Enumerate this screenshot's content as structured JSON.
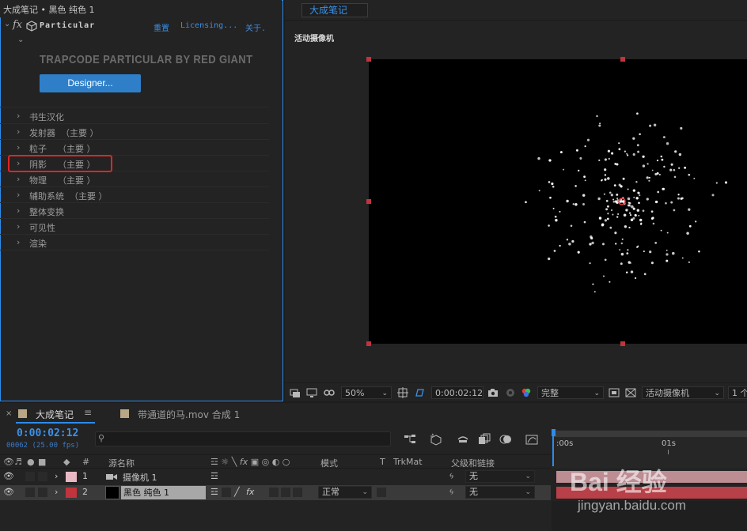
{
  "effect_controls": {
    "title": "大成笔记 • 黑色 纯色 1",
    "fx_label": "fx",
    "effect_name": "Particular",
    "reset": "重置",
    "licensing": "Licensing...",
    "about": "关于.",
    "plugin_title": "TRAPCODE PARTICULAR BY RED GIANT",
    "designer_button": "Designer...",
    "groups": [
      "书生汉化",
      "发射器  （主要 ）",
      "粒子    （主要 ）",
      "阴影    （主要 ）",
      "物理    （主要 ）",
      "辅助系统  （主要 ）",
      "整体变换",
      "可见性",
      "渲染"
    ],
    "highlighted_group": "阴影    （主要 ）"
  },
  "composition": {
    "tab_label": "大成笔记",
    "camera_label": "活动摄像机",
    "toolbar": {
      "zoom": "50%",
      "timecode": "0:00:02:12",
      "resolution": "完整",
      "view": "活动摄像机",
      "views_count": "1 个"
    }
  },
  "timeline": {
    "tabs": [
      {
        "label": "大成笔记",
        "menu": "≡",
        "close": "×"
      },
      {
        "label": "带通道的马.mov 合成 1"
      }
    ],
    "current_time": "0:00:02:12",
    "frames": "00062 (25.00 fps)",
    "columns": {
      "number": "#",
      "source_name": "源名称",
      "mode": "模式",
      "t": "T",
      "trkmat": "TrkMat",
      "parent": "父级和链接"
    },
    "layers": [
      {
        "index": "1",
        "name": "摄像机 1",
        "label_color": "#e8b8c4",
        "mode": "",
        "parent": "无"
      },
      {
        "index": "2",
        "name": "黑色 纯色 1",
        "label_color": "#c0343d",
        "mode": "正常",
        "parent": "无"
      }
    ],
    "ruler": {
      "start": ":00s",
      "second": "01s"
    }
  },
  "watermark": {
    "text": "Bai 经验",
    "url": "jingyan.baidu.com"
  },
  "colors": {
    "accent_blue": "#2d8ceb",
    "highlight_red": "#e02525",
    "handle_red": "#c0343d"
  }
}
